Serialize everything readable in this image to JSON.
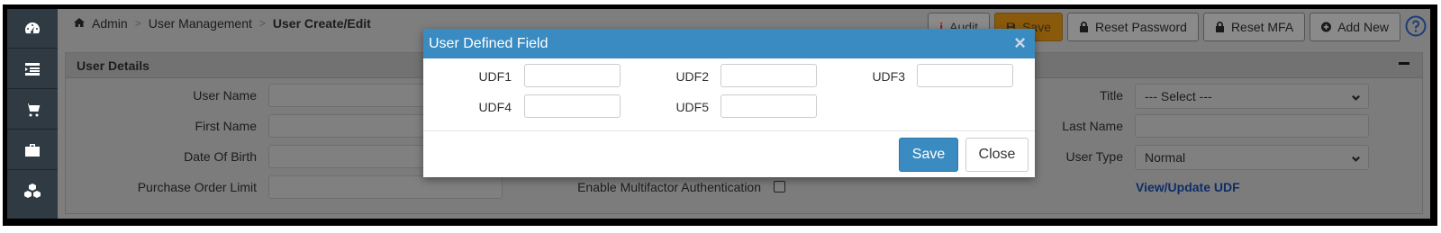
{
  "breadcrumb": {
    "items": [
      "Admin",
      "User Management"
    ],
    "current": "User Create/Edit",
    "separator": ">"
  },
  "toolbar": {
    "audit_label": "Audit",
    "save_label": "Save",
    "reset_password_label": "Reset Password",
    "reset_mfa_label": "Reset MFA",
    "add_new_label": "Add New"
  },
  "panel": {
    "title": "User Details",
    "fields": {
      "user_name": "User Name",
      "first_name": "First Name",
      "date_of_birth": "Date Of Birth",
      "purchase_order_limit": "Purchase Order Limit",
      "enable_mfa": "Enable Multifactor Authentication",
      "title": "Title",
      "title_value": "--- Select ---",
      "last_name": "Last Name",
      "user_type": "User Type",
      "user_type_value": "Normal",
      "view_update_udf": "View/Update UDF"
    }
  },
  "modal": {
    "title": "User Defined Field",
    "close_symbol": "×",
    "fields": [
      {
        "label": "UDF1",
        "value": ""
      },
      {
        "label": "UDF2",
        "value": ""
      },
      {
        "label": "UDF3",
        "value": ""
      },
      {
        "label": "UDF4",
        "value": ""
      },
      {
        "label": "UDF5",
        "value": ""
      }
    ],
    "save_label": "Save",
    "close_label": "Close"
  },
  "sidebar": {
    "icons": [
      "dashboard-icon",
      "list-icon",
      "cart-icon",
      "briefcase-icon",
      "cubes-icon"
    ]
  },
  "colors": {
    "modal_header": "#3a8bc1",
    "primary_button": "#3a8bc1",
    "sidebar": "#2f3a42",
    "link": "#0e2d66"
  }
}
